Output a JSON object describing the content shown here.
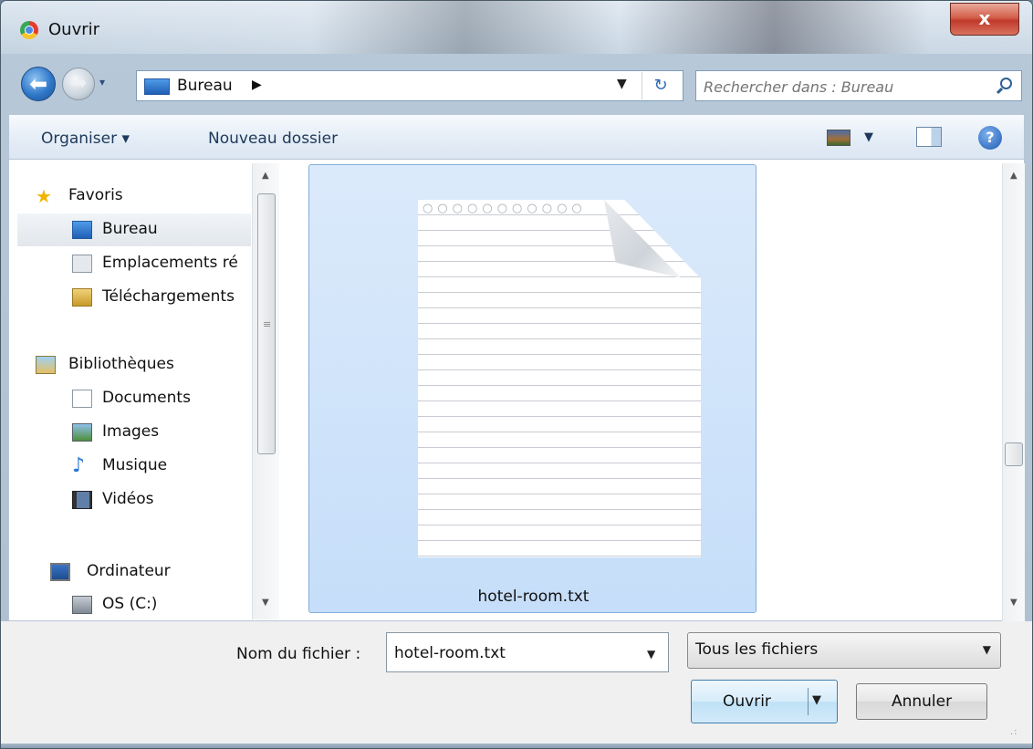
{
  "window": {
    "title": "Ouvrir",
    "close_label": "x"
  },
  "address": {
    "back_glyph": "⬅",
    "forward_glyph": "➡",
    "recent_glyph": "▾",
    "location": "Bureau",
    "separator": "▶",
    "dropdown_glyph": "▼",
    "refresh_glyph": "↻"
  },
  "search": {
    "placeholder": "Rechercher dans : Bureau"
  },
  "toolbar": {
    "organiser_label": "Organiser ▾",
    "nouveau_dossier_label": "Nouveau dossier",
    "view_dropdown_glyph": "▼",
    "help_glyph": "?"
  },
  "navigation": {
    "items": [
      {
        "label": "Favoris",
        "icon": "star-icon"
      },
      {
        "label": "Bureau",
        "icon": "desktop-icon",
        "selected": true
      },
      {
        "label": "Emplacements ré",
        "icon": "recent-places-icon"
      },
      {
        "label": "Téléchargements",
        "icon": "downloads-icon"
      },
      {
        "label": "Bibliothèques",
        "icon": "libraries-icon"
      },
      {
        "label": "Documents",
        "icon": "documents-icon"
      },
      {
        "label": "Images",
        "icon": "images-icon"
      },
      {
        "label": "Musique",
        "icon": "music-icon"
      },
      {
        "label": "Vidéos",
        "icon": "videos-icon"
      },
      {
        "label": "Ordinateur",
        "icon": "computer-icon"
      },
      {
        "label": "OS (C:)",
        "icon": "drive-icon"
      }
    ]
  },
  "files": [
    {
      "name": "hotel-room.txt",
      "icon": "text-file-icon",
      "selected": true
    }
  ],
  "bottom": {
    "filename_label": "Nom du fichier :",
    "filename_value": "hotel-room.txt",
    "filetype_value": "Tous les fichiers",
    "open_label": "Ouvrir",
    "cancel_label": "Annuler",
    "dropdown_glyph": "▼"
  },
  "colors": {
    "selection": "#c6def9",
    "close_button": "#c0392b",
    "toolbar_text": "#1e395b"
  }
}
